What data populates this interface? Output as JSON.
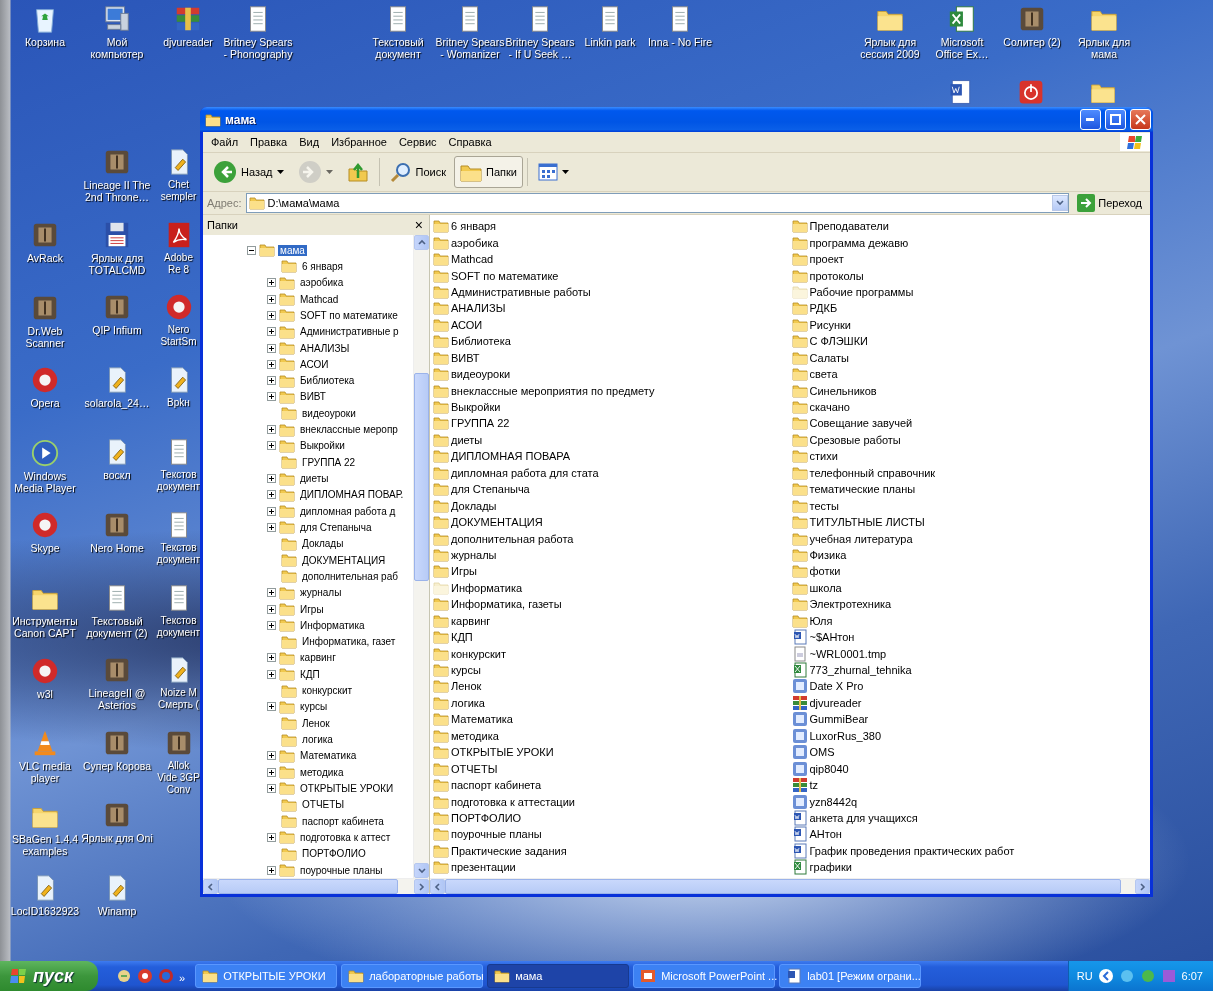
{
  "desktop": {
    "top_icons": [
      {
        "kind": "recycle",
        "label": "Корзина"
      },
      {
        "kind": "computer",
        "label": "Мой компьютер"
      },
      {
        "kind": "books",
        "label": "djvureader"
      },
      {
        "kind": "text",
        "label": "Britney Spears - Phonography"
      },
      {
        "kind": "text",
        "label": "Текстовый документ"
      },
      {
        "kind": "text",
        "label": "Britney Spears - Womanizer"
      },
      {
        "kind": "text",
        "label": "Britney Spears - If U Seek …"
      },
      {
        "kind": "text",
        "label": "Linkin park"
      },
      {
        "kind": "text",
        "label": "Inna - No Fire"
      },
      {
        "kind": "folder",
        "label": "Ярлык для сессия 2009"
      },
      {
        "kind": "excel",
        "label": "Microsoft Office Ex…"
      },
      {
        "kind": "app",
        "label": "Солитер (2)"
      },
      {
        "kind": "folder",
        "label": "Ярлык для мама"
      }
    ],
    "unlabeled_icons": [
      {
        "kind": "word"
      },
      {
        "kind": "power"
      },
      {
        "kind": "folder"
      }
    ],
    "columns": [
      {
        "items": [
          {
            "kind": "app",
            "label": "AvRack"
          },
          {
            "kind": "app",
            "label": "Dr.Web Scanner"
          },
          {
            "kind": "round",
            "label": "Opera"
          },
          {
            "kind": "play",
            "label": "Windows Media Player"
          },
          {
            "kind": "round",
            "label": "Skype"
          },
          {
            "kind": "folder",
            "label": "Инструменты Canon CAPT"
          },
          {
            "kind": "round",
            "label": "w3l"
          },
          {
            "kind": "cone",
            "label": "VLC media player"
          },
          {
            "kind": "folder",
            "label": "SBaGen 1.4.4 examples"
          },
          {
            "kind": "script",
            "label": "LocID1632923"
          }
        ]
      },
      {
        "items": [
          {
            "kind": "app",
            "label": "Lineage II The 2nd Throne…"
          },
          {
            "kind": "drive",
            "label": "Ярлык для TOTALCMD"
          },
          {
            "kind": "app",
            "label": "QIP Infium"
          },
          {
            "kind": "script",
            "label": "solarola_24…"
          },
          {
            "kind": "script",
            "label": "воскл"
          },
          {
            "kind": "app",
            "label": "Nero Home"
          },
          {
            "kind": "text",
            "label": "Текстовый документ (2)"
          },
          {
            "kind": "app",
            "label": "LineageII @ Asterios"
          },
          {
            "kind": "app",
            "label": "Супер Корова"
          },
          {
            "kind": "app",
            "label": "Ярлык для Oni"
          },
          {
            "kind": "script",
            "label": "Winamp"
          }
        ]
      },
      {
        "items": [
          {
            "kind": "script",
            "label": "Chet sempler"
          },
          {
            "kind": "pdf",
            "label": "Adobe Re 8"
          },
          {
            "kind": "round",
            "label": "Nero StartSm"
          },
          {
            "kind": "script",
            "label": "Врkн"
          },
          {
            "kind": "text",
            "label": "Текстов документ"
          },
          {
            "kind": "text",
            "label": "Текстов документ"
          },
          {
            "kind": "text",
            "label": "Текстов документ"
          },
          {
            "kind": "script",
            "label": "Noize M Смерть ("
          },
          {
            "kind": "app",
            "label": "Allok Vide 3GP Conv"
          }
        ]
      }
    ]
  },
  "window": {
    "title": "мама",
    "menu": [
      "Файл",
      "Правка",
      "Вид",
      "Избранное",
      "Сервис",
      "Справка"
    ],
    "toolbar": [
      {
        "kind": "back",
        "label": "Назад",
        "selected": false,
        "disabled": false
      },
      {
        "kind": "forward",
        "selected": false,
        "disabled": true
      },
      {
        "kind": "up",
        "selected": false,
        "disabled": false
      },
      {
        "kind": "search",
        "label": "Поиск",
        "selected": false,
        "disabled": false
      },
      {
        "kind": "folders",
        "label": "Папки",
        "selected": true,
        "disabled": false
      },
      {
        "kind": "views",
        "selected": false,
        "disabled": false
      }
    ],
    "address": {
      "label": "Адрес:",
      "value": "D:\\мама\\мама",
      "go": "Переход"
    },
    "folders_pane": {
      "title": "Папки",
      "close": "×",
      "tree": [
        {
          "label": "мама",
          "expanded": true,
          "selected": true,
          "children": [
            {
              "label": "6 января",
              "kind": "leaf",
              "selected": false
            },
            {
              "label": "аэробика",
              "kind": "branch",
              "selected": false
            },
            {
              "label": "Mathcad",
              "kind": "branch",
              "selected": false
            },
            {
              "label": "SOFT по математике",
              "kind": "branch",
              "selected": false
            },
            {
              "label": "Административные р",
              "kind": "branch",
              "selected": false
            },
            {
              "label": "АНАЛИЗЫ",
              "kind": "branch",
              "selected": false
            },
            {
              "label": "АСОИ",
              "kind": "branch",
              "selected": false
            },
            {
              "label": "Библиотека",
              "kind": "branch",
              "selected": false
            },
            {
              "label": "ВИВТ",
              "kind": "branch",
              "selected": false
            },
            {
              "label": "видеоуроки",
              "kind": "leaf",
              "selected": false
            },
            {
              "label": "внеклассные меропр",
              "kind": "branch",
              "selected": false
            },
            {
              "label": "Выкройки",
              "kind": "branch",
              "selected": false
            },
            {
              "label": "ГРУППА 22",
              "kind": "leaf",
              "selected": false
            },
            {
              "label": "диеты",
              "kind": "branch",
              "selected": false
            },
            {
              "label": "ДИПЛОМНАЯ ПОВАР.",
              "kind": "branch",
              "selected": false
            },
            {
              "label": "дипломная работа д",
              "kind": "branch",
              "selected": false
            },
            {
              "label": "для Степаныча",
              "kind": "branch",
              "selected": false
            },
            {
              "label": "Доклады",
              "kind": "leaf",
              "selected": false
            },
            {
              "label": "ДОКУМЕНТАЦИЯ",
              "kind": "leaf",
              "selected": false
            },
            {
              "label": "дополнительная раб",
              "kind": "leaf",
              "selected": false
            },
            {
              "label": "журналы",
              "kind": "branch",
              "selected": false
            },
            {
              "label": "Игры",
              "kind": "branch",
              "selected": false
            },
            {
              "label": "Информатика",
              "kind": "branch",
              "selected": false
            },
            {
              "label": "Информатика, газет",
              "kind": "leaf",
              "selected": false
            },
            {
              "label": "карвинг",
              "kind": "branch",
              "selected": false
            },
            {
              "label": "КДП",
              "kind": "branch",
              "selected": false
            },
            {
              "label": "конкурскит",
              "kind": "leaf",
              "selected": false
            },
            {
              "label": "курсы",
              "kind": "branch",
              "selected": false
            },
            {
              "label": "Ленок",
              "kind": "leaf",
              "selected": false
            },
            {
              "label": "логика",
              "kind": "leaf",
              "selected": false
            },
            {
              "label": "Математика",
              "kind": "branch",
              "selected": false
            },
            {
              "label": "методика",
              "kind": "branch",
              "selected": false
            },
            {
              "label": "ОТКРЫТЫЕ УРОКИ",
              "kind": "branch",
              "selected": false
            },
            {
              "label": "ОТЧЕТЫ",
              "kind": "leaf",
              "selected": false
            },
            {
              "label": "паспорт кабинета",
              "kind": "leaf",
              "selected": false
            },
            {
              "label": "подготовка к аттест",
              "kind": "branch",
              "selected": false
            },
            {
              "label": "ПОРТФОЛИО",
              "kind": "leaf",
              "selected": false
            },
            {
              "label": "поурочные планы",
              "kind": "branch",
              "selected": false
            }
          ]
        }
      ]
    },
    "file_list": {
      "columns": [
        {
          "items": [
            {
              "kind": "folder",
              "name": "6 января"
            },
            {
              "kind": "folder",
              "name": "аэробика"
            },
            {
              "kind": "folder",
              "name": "Mathcad"
            },
            {
              "kind": "folder",
              "name": "SOFT по математике"
            },
            {
              "kind": "folder",
              "name": "Административные работы"
            },
            {
              "kind": "folder",
              "name": "АНАЛИЗЫ"
            },
            {
              "kind": "folder",
              "name": "АСОИ"
            },
            {
              "kind": "folder",
              "name": "Библиотека"
            },
            {
              "kind": "folder",
              "name": "ВИВТ"
            },
            {
              "kind": "folder",
              "name": "видеоуроки"
            },
            {
              "kind": "folder",
              "name": "внеклассные мероприятия по предмету"
            },
            {
              "kind": "folder",
              "name": "Выкройки"
            },
            {
              "kind": "folder",
              "name": "ГРУППА 22"
            },
            {
              "kind": "folder",
              "name": "диеты"
            },
            {
              "kind": "folder",
              "name": "ДИПЛОМНАЯ ПОВАРА"
            },
            {
              "kind": "folder",
              "name": "дипломная работа для стата"
            },
            {
              "kind": "folder",
              "name": "для Степаныча"
            },
            {
              "kind": "folder",
              "name": "Доклады"
            },
            {
              "kind": "folder",
              "name": "ДОКУМЕНТАЦИЯ"
            },
            {
              "kind": "folder",
              "name": "дополнительная работа"
            },
            {
              "kind": "folder",
              "name": "журналы"
            },
            {
              "kind": "folder",
              "name": "Игры"
            },
            {
              "kind": "faded-folder",
              "name": "Информатика"
            },
            {
              "kind": "folder",
              "name": "Информатика, газеты"
            },
            {
              "kind": "folder",
              "name": "карвинг"
            },
            {
              "kind": "folder",
              "name": "КДП"
            },
            {
              "kind": "folder",
              "name": "конкурскит"
            },
            {
              "kind": "folder",
              "name": "курсы"
            },
            {
              "kind": "folder",
              "name": "Ленок"
            },
            {
              "kind": "folder",
              "name": "логика"
            },
            {
              "kind": "folder",
              "name": "Математика"
            },
            {
              "kind": "folder",
              "name": "методика"
            },
            {
              "kind": "folder",
              "name": "ОТКРЫТЫЕ УРОКИ"
            },
            {
              "kind": "folder",
              "name": "ОТЧЕТЫ"
            },
            {
              "kind": "folder",
              "name": "паспорт кабинета"
            },
            {
              "kind": "folder",
              "name": "подготовка к аттестации"
            },
            {
              "kind": "folder",
              "name": "ПОРТФОЛИО"
            },
            {
              "kind": "folder",
              "name": "поурочные планы"
            },
            {
              "kind": "folder",
              "name": "Практические задания"
            },
            {
              "kind": "folder",
              "name": "презентации"
            }
          ]
        },
        {
          "items": [
            {
              "kind": "folder",
              "name": "Преподаватели"
            },
            {
              "kind": "folder",
              "name": "программа дежавю"
            },
            {
              "kind": "folder",
              "name": "проект"
            },
            {
              "kind": "folder",
              "name": "протоколы"
            },
            {
              "kind": "faded-folder",
              "name": "Рабочие программы"
            },
            {
              "kind": "folder",
              "name": "РДКБ"
            },
            {
              "kind": "folder",
              "name": "Рисунки"
            },
            {
              "kind": "folder",
              "name": "С ФЛЭШКИ"
            },
            {
              "kind": "folder",
              "name": "Салаты"
            },
            {
              "kind": "folder",
              "name": "света"
            },
            {
              "kind": "folder",
              "name": "Синельников"
            },
            {
              "kind": "folder",
              "name": "скачано"
            },
            {
              "kind": "folder",
              "name": "Совещание завучей"
            },
            {
              "kind": "folder",
              "name": "Срезовые работы"
            },
            {
              "kind": "folder",
              "name": "стихи"
            },
            {
              "kind": "folder",
              "name": "телефонный справочник"
            },
            {
              "kind": "folder",
              "name": "тематические планы"
            },
            {
              "kind": "folder",
              "name": "тесты"
            },
            {
              "kind": "folder",
              "name": "ТИТУЛЬТНЫЕ ЛИСТЫ"
            },
            {
              "kind": "folder",
              "name": "учебная литература"
            },
            {
              "kind": "folder",
              "name": "Физика"
            },
            {
              "kind": "folder",
              "name": "фотки"
            },
            {
              "kind": "folder",
              "name": "школа"
            },
            {
              "kind": "folder",
              "name": "Электротехника"
            },
            {
              "kind": "folder",
              "name": "Юля"
            },
            {
              "kind": "word",
              "name": "~$АНтон"
            },
            {
              "kind": "temp",
              "name": "~WRL0001.tmp"
            },
            {
              "kind": "excel",
              "name": "773_zhurnal_tehnika"
            },
            {
              "kind": "program",
              "name": "Date X Pro"
            },
            {
              "kind": "archive",
              "name": "djvureader"
            },
            {
              "kind": "program",
              "name": "GummiBear"
            },
            {
              "kind": "program",
              "name": "LuxorRus_380"
            },
            {
              "kind": "program",
              "name": "OMS"
            },
            {
              "kind": "program",
              "name": "qip8040"
            },
            {
              "kind": "archive",
              "name": "tz"
            },
            {
              "kind": "program",
              "name": "yzn8442q"
            },
            {
              "kind": "word",
              "name": "анкета для учащихся"
            },
            {
              "kind": "word",
              "name": "АНтон"
            },
            {
              "kind": "word",
              "name": "График проведения практических работ"
            },
            {
              "kind": "excel",
              "name": "графики"
            }
          ]
        }
      ]
    }
  },
  "taskbar": {
    "start": "пуск",
    "more": "»",
    "tasks": [
      {
        "kind": "folder",
        "label": "ОТКРЫТЫЕ УРОКИ",
        "selected": false
      },
      {
        "kind": "folder",
        "label": "лабораторные работы",
        "selected": false
      },
      {
        "kind": "folder",
        "label": "мама",
        "selected": true
      },
      {
        "kind": "powerpoint",
        "label": "Microsoft PowerPoint ...",
        "selected": false
      },
      {
        "kind": "word",
        "label": "lab01 [Режим ограни...",
        "selected": false
      }
    ],
    "language": "RU",
    "time": "6:07"
  }
}
